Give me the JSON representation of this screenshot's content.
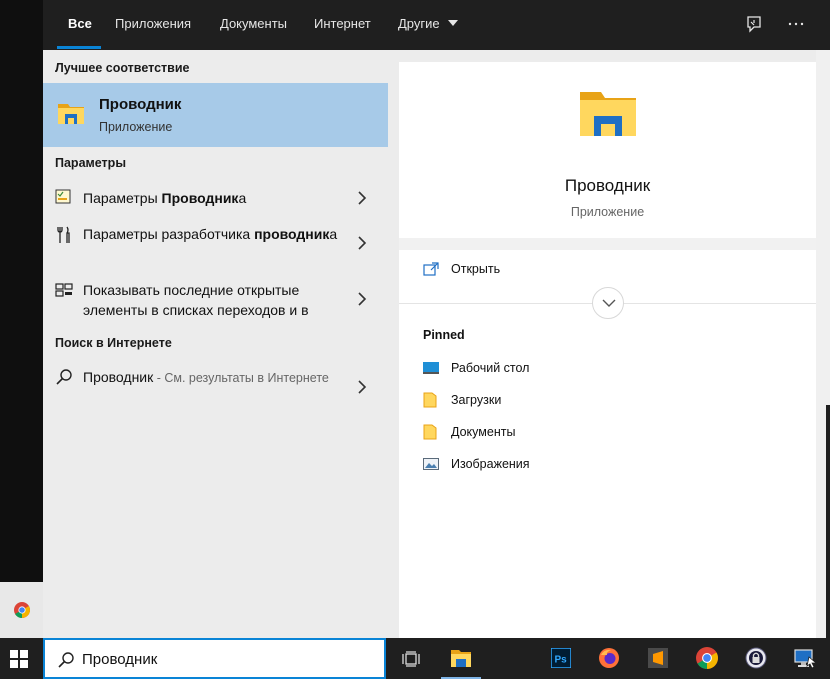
{
  "tabs": [
    {
      "label": "Все",
      "active": true
    },
    {
      "label": "Приложения"
    },
    {
      "label": "Документы"
    },
    {
      "label": "Интернет"
    },
    {
      "label": "Другие"
    }
  ],
  "top_icons": [
    "feedback-icon",
    "more-options-icon"
  ],
  "left": {
    "best_match_title": "Лучшее соответствие",
    "best_match": {
      "name": "Проводник",
      "type": "Приложение",
      "icon": "file-explorer-icon"
    },
    "settings_title": "Параметры",
    "settings": [
      {
        "icon": "settings-checklist-icon",
        "text_normal": "Параметры ",
        "text_bold": "Проводник",
        "text_after": "а"
      },
      {
        "icon": "developer-tools-icon",
        "text_normal": "Параметры разработчика ",
        "text_bold": "проводник",
        "text_after": "а"
      },
      {
        "icon": "jump-list-icon",
        "text_normal": "Показывать последние открытые элементы в списках переходов и в",
        "text_bold": "",
        "text_after": ""
      }
    ],
    "web_title": "Поиск в Интернете",
    "web": {
      "query": "Проводник",
      "hint": " - См. результаты в Интернете"
    }
  },
  "preview": {
    "title": "Проводник",
    "subtitle": "Приложение",
    "action": "Открыть",
    "pinned_title": "Pinned",
    "pinned": [
      {
        "label": "Рабочий стол",
        "icon": "desktop-icon"
      },
      {
        "label": "Загрузки",
        "icon": "folder-icon"
      },
      {
        "label": "Документы",
        "icon": "folder-icon"
      },
      {
        "label": "Изображения",
        "icon": "pictures-icon"
      }
    ]
  },
  "search": {
    "value": "Проводник"
  },
  "taskbar_apps": [
    "task-view-icon",
    "file-explorer-icon",
    "photoshop-icon",
    "firefox-icon",
    "sublime-text-icon",
    "chrome-icon",
    "keepass-icon",
    "remote-desktop-icon"
  ],
  "colors": {
    "accent": "#0a84d6",
    "selection": "#a7cae8"
  }
}
